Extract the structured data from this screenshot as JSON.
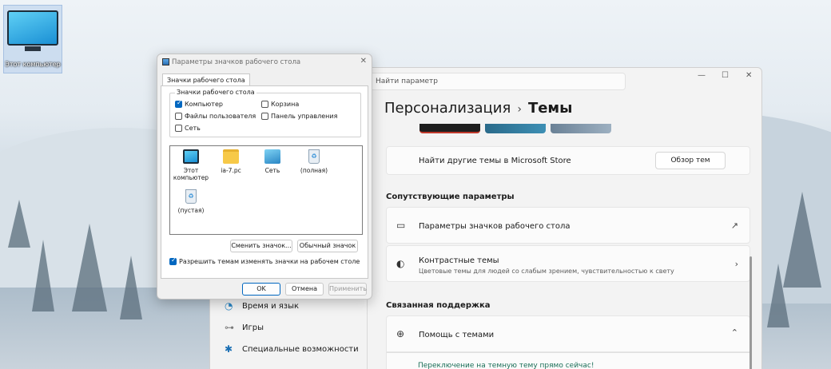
{
  "desktop": {
    "icon_label": "Этот компьютер"
  },
  "settings": {
    "search_placeholder": "Найти параметр",
    "breadcrumb_parent": "Персонализация",
    "breadcrumb_sep": "›",
    "breadcrumb_current": "Темы",
    "store_text": "Найти другие темы в Microsoft Store",
    "store_button": "Обзор тем",
    "related_header": "Сопутствующие параметры",
    "desktop_icons_item": "Параметры значков рабочего стола",
    "contrast_title": "Контрастные темы",
    "contrast_sub": "Цветовые темы для людей со слабым зрением, чувствительностью к свету",
    "support_header": "Связанная поддержка",
    "help_item": "Помощь с темами",
    "help_link": "Переключение на темную тему прямо сейчас!",
    "nav": [
      "Время и язык",
      "Игры",
      "Специальные возможности"
    ],
    "window_controls": [
      "—",
      "☐",
      "✕"
    ]
  },
  "dialog": {
    "title": "Параметры значков рабочего стола",
    "close": "✕",
    "tab": "Значки рабочего стола",
    "group_label": "Значки рабочего стола",
    "checkboxes": [
      {
        "label": "Компьютер",
        "checked": true
      },
      {
        "label": "Корзина",
        "checked": false
      },
      {
        "label": "Файлы пользователя",
        "checked": false
      },
      {
        "label": "Панель управления",
        "checked": false
      },
      {
        "label": "Сеть",
        "checked": false
      }
    ],
    "icons": [
      "Этот компьютер",
      "ia-7.pc",
      "Сеть",
      "(полная)",
      "(пустая)"
    ],
    "bin_glyph": "♻",
    "change_icon": "Сменить значок...",
    "default_icon": "Обычный значок",
    "allow_themes": "Разрешить темам изменять значки на рабочем столе",
    "allow_checked": true,
    "ok": "OK",
    "cancel": "Отмена",
    "apply": "Применить"
  },
  "colors": {
    "accent": "#0067c0",
    "link": "#1a6e57"
  }
}
